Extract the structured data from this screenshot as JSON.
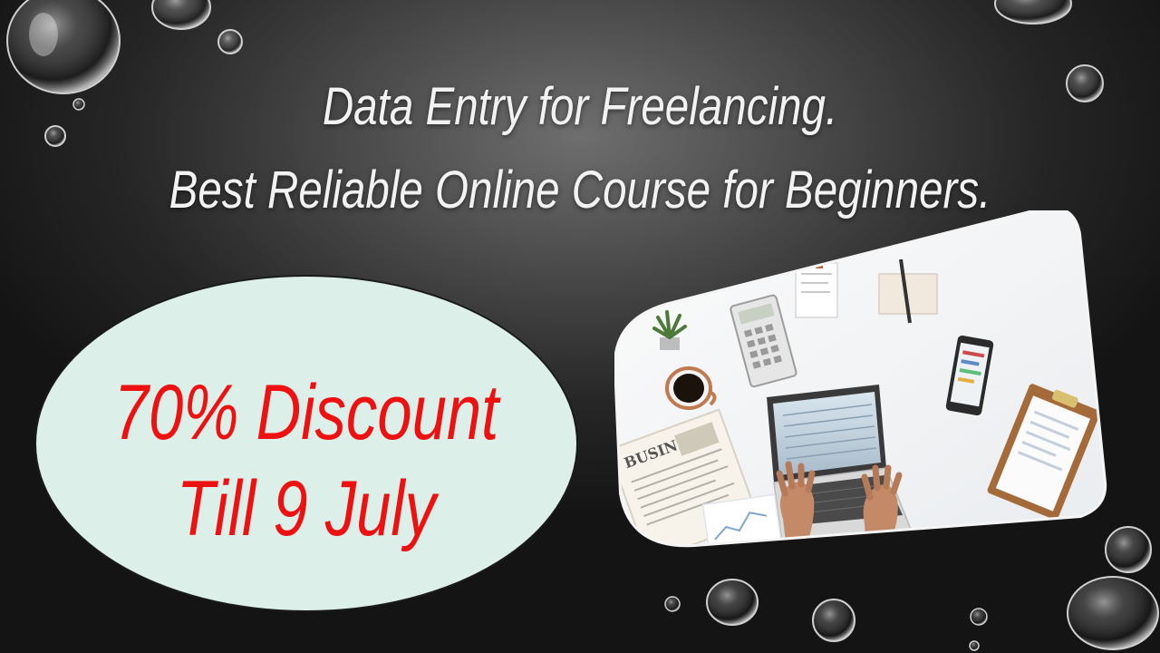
{
  "headline": {
    "line1": "Data Entry for Freelancing.",
    "line2": "Best Reliable Online Course for Beginners."
  },
  "promo": {
    "line1": "70% Discount",
    "line2": "Till 9 July"
  },
  "photo": {
    "newspaper_text": "BUSINESS"
  },
  "colors": {
    "background": "#2b2b2b",
    "headline_text": "#f2f2f2",
    "promo_text": "#ee1111",
    "ellipse_fill": "#dcefe9"
  }
}
